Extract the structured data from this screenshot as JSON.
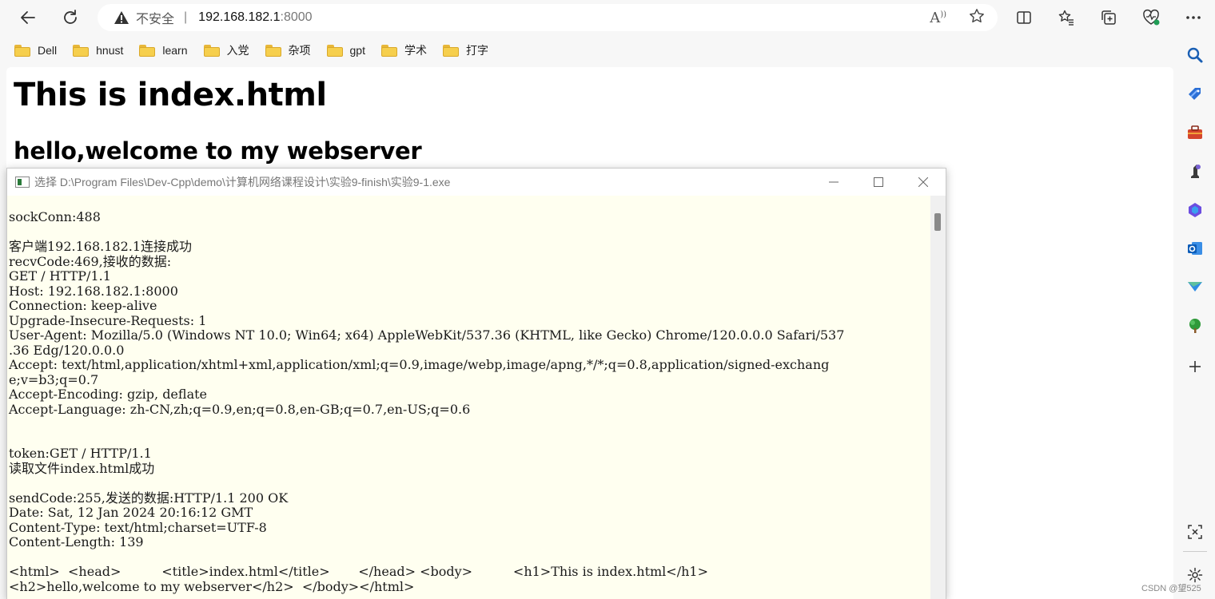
{
  "browser": {
    "address": {
      "insecure_label": "不安全",
      "separator": "|",
      "host": "192.168.182.1",
      "port": ":8000"
    },
    "bookmarks": [
      {
        "label": "Dell"
      },
      {
        "label": "hnust"
      },
      {
        "label": "learn"
      },
      {
        "label": "入党"
      },
      {
        "label": "杂项"
      },
      {
        "label": "gpt"
      },
      {
        "label": "学术"
      },
      {
        "label": "打字"
      }
    ],
    "sidebar_icons": [
      "search-icon",
      "shopping-tag-icon",
      "toolbox-icon",
      "chess-icon",
      "copilot-icon",
      "outlook-icon",
      "send-icon",
      "tree-icon",
      "add-icon",
      "screenshot-icon",
      "settings-icon"
    ]
  },
  "page": {
    "h1": "This is index.html",
    "h2": "hello,welcome to my webserver"
  },
  "console": {
    "title": "选择 D:\\Program Files\\Dev-Cpp\\demo\\计算机网络课程设计\\实验9-finish\\实验9-1.exe",
    "lines": [
      "sockConn:488",
      "",
      "客户端192.168.182.1连接成功",
      "recvCode:469,接收的数据:",
      "GET / HTTP/1.1",
      "Host: 192.168.182.1:8000",
      "Connection: keep-alive",
      "Upgrade-Insecure-Requests: 1",
      "User-Agent: Mozilla/5.0 (Windows NT 10.0; Win64; x64) AppleWebKit/537.36 (KHTML, like Gecko) Chrome/120.0.0.0 Safari/537",
      ".36 Edg/120.0.0.0",
      "Accept: text/html,application/xhtml+xml,application/xml;q=0.9,image/webp,image/apng,*/*;q=0.8,application/signed-exchang",
      "e;v=b3;q=0.7",
      "Accept-Encoding: gzip, deflate",
      "Accept-Language: zh-CN,zh;q=0.9,en;q=0.8,en-GB;q=0.7,en-US;q=0.6",
      "",
      "",
      "token:GET / HTTP/1.1",
      "读取文件index.html成功",
      "",
      "sendCode:255,发送的数据:HTTP/1.1 200 OK",
      "Date: Sat, 12 Jan 2024 20:16:12 GMT",
      "Content-Type: text/html;charset=UTF-8",
      "Content-Length: 139",
      "",
      "<html>  <head>          <title>index.html</title>       </head> <body>          <h1>This is index.html</h1>",
      "<h2>hello,welcome to my webserver</h2>  </body></html>"
    ]
  },
  "watermark": "CSDN @望525"
}
